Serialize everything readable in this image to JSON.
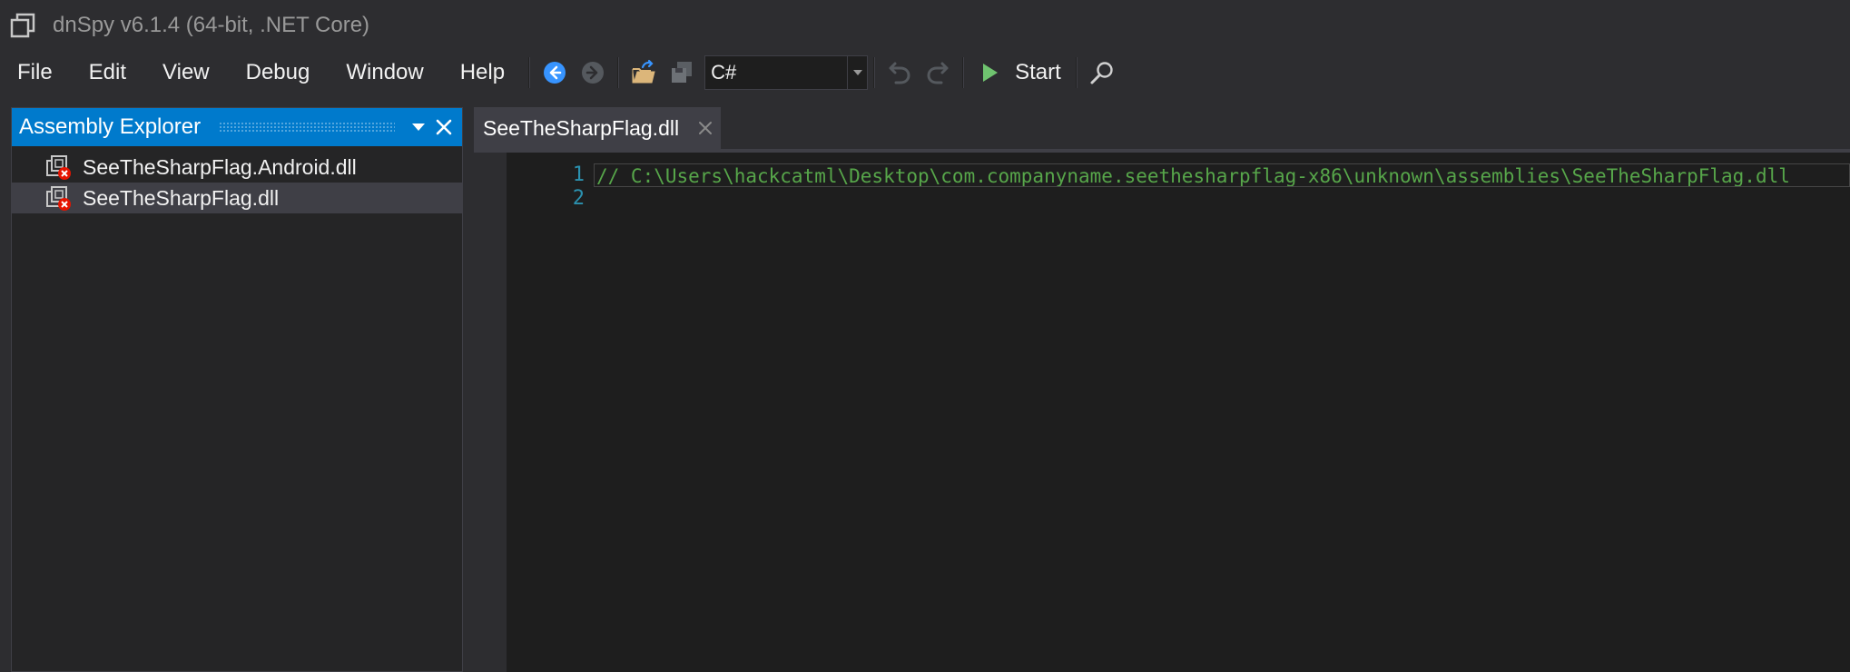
{
  "window": {
    "title": "dnSpy v6.1.4 (64-bit, .NET Core)"
  },
  "menu": {
    "items": [
      "File",
      "Edit",
      "View",
      "Debug",
      "Window",
      "Help"
    ]
  },
  "toolbar": {
    "language": "C#",
    "start_label": "Start"
  },
  "explorer": {
    "title": "Assembly Explorer",
    "items": [
      {
        "label": "SeeTheSharpFlag.Android.dll"
      },
      {
        "label": "SeeTheSharpFlag.dll"
      }
    ]
  },
  "editor": {
    "tab_label": "SeeTheSharpFlag.dll",
    "line_numbers": [
      "1",
      "2"
    ],
    "lines": [
      "// C:\\Users\\hackcatml\\Desktop\\com.companyname.seethesharpflag-x86\\unknown\\assemblies\\SeeTheSharpFlag.dll",
      ""
    ]
  },
  "colors": {
    "accent": "#007acc",
    "comment": "#57a64a",
    "line_number": "#2b91af",
    "play": "#6fc36f"
  }
}
